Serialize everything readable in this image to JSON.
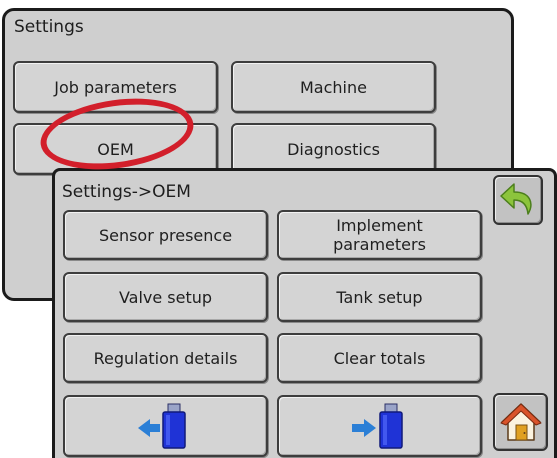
{
  "settings_screen": {
    "title": "Settings",
    "buttons": {
      "job_parameters": "Job parameters",
      "machine": "Machine",
      "oem": "OEM",
      "diagnostics": "Diagnostics"
    },
    "highlighted_button": "OEM"
  },
  "oem_screen": {
    "title": "Settings->OEM",
    "buttons": {
      "sensor_presence": "Sensor presence",
      "implement_parameters_line1": "Implement",
      "implement_parameters_line2": "parameters",
      "valve_setup": "Valve setup",
      "tank_setup": "Tank setup",
      "regulation_details": "Regulation details",
      "clear_totals": "Clear totals"
    },
    "icons": {
      "back": "back-arrow-icon",
      "usb_import": "usb-import-icon",
      "usb_export": "usb-export-icon",
      "home": "home-icon"
    }
  },
  "colors": {
    "panel": "#cfcfcf",
    "button": "#d4d4d4",
    "highlight_ring": "#d21f2b",
    "back_arrow": "#8cc43c",
    "usb_blue": "#1f33d6",
    "arrow_blue": "#2b7fd6",
    "home_roof": "#d9532a"
  }
}
